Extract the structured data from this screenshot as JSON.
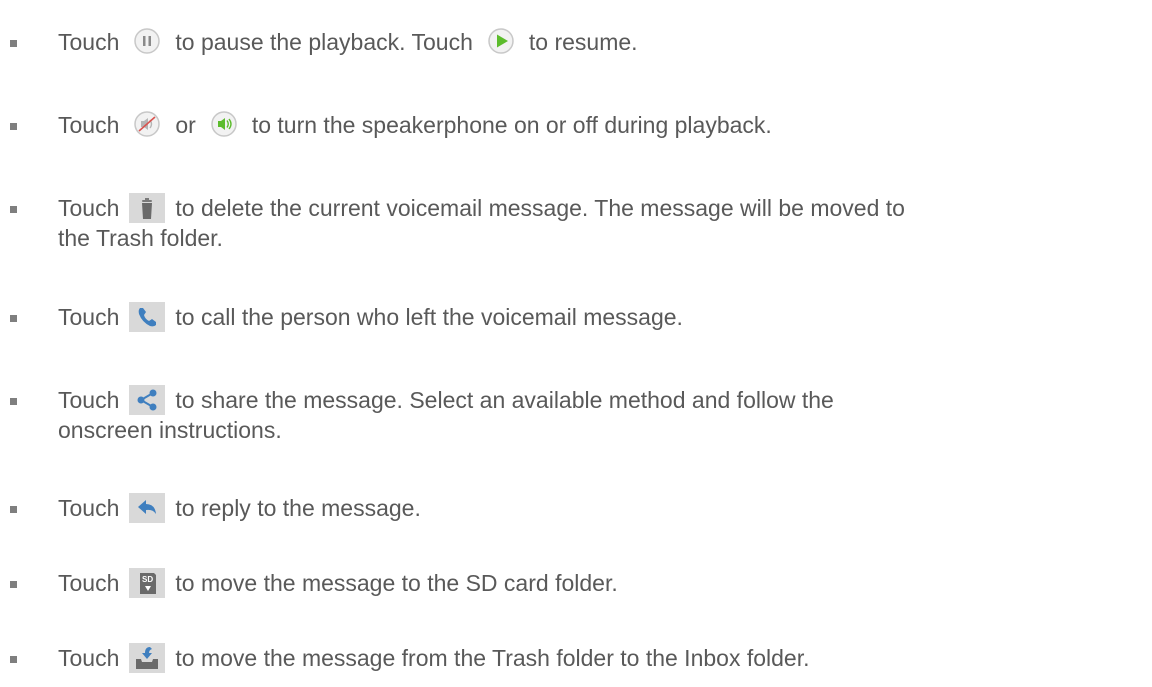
{
  "items": [
    {
      "pre": "Touch",
      "icon": "pause-icon",
      "mid": "to pause the playback. Touch",
      "icon2": "play-icon",
      "post": "to resume."
    },
    {
      "pre": "Touch",
      "icon": "speaker-off-icon",
      "mid": "or",
      "icon2": "speaker-on-icon",
      "post": "to turn the speakerphone on or off during playback."
    },
    {
      "pre": "Touch",
      "icon": "trash-icon",
      "post": "to delete the current voicemail message. The message will be moved to",
      "cont": "the Trash folder."
    },
    {
      "pre": "Touch",
      "icon": "phone-icon",
      "post": "to call the person who left the voicemail message."
    },
    {
      "pre": "Touch",
      "icon": "share-icon",
      "post": "to share the message. Select an available method and follow the",
      "cont": "onscreen instructions."
    },
    {
      "pre": "Touch",
      "icon": "reply-icon",
      "post": "to reply to the message."
    },
    {
      "pre": "Touch",
      "icon": "sd-card-icon",
      "icon_text": "SD",
      "post": "to move the message to the SD card folder."
    },
    {
      "pre": "Touch",
      "icon": "move-to-inbox-icon",
      "post": "to move the message from the Trash folder to the Inbox folder."
    }
  ]
}
